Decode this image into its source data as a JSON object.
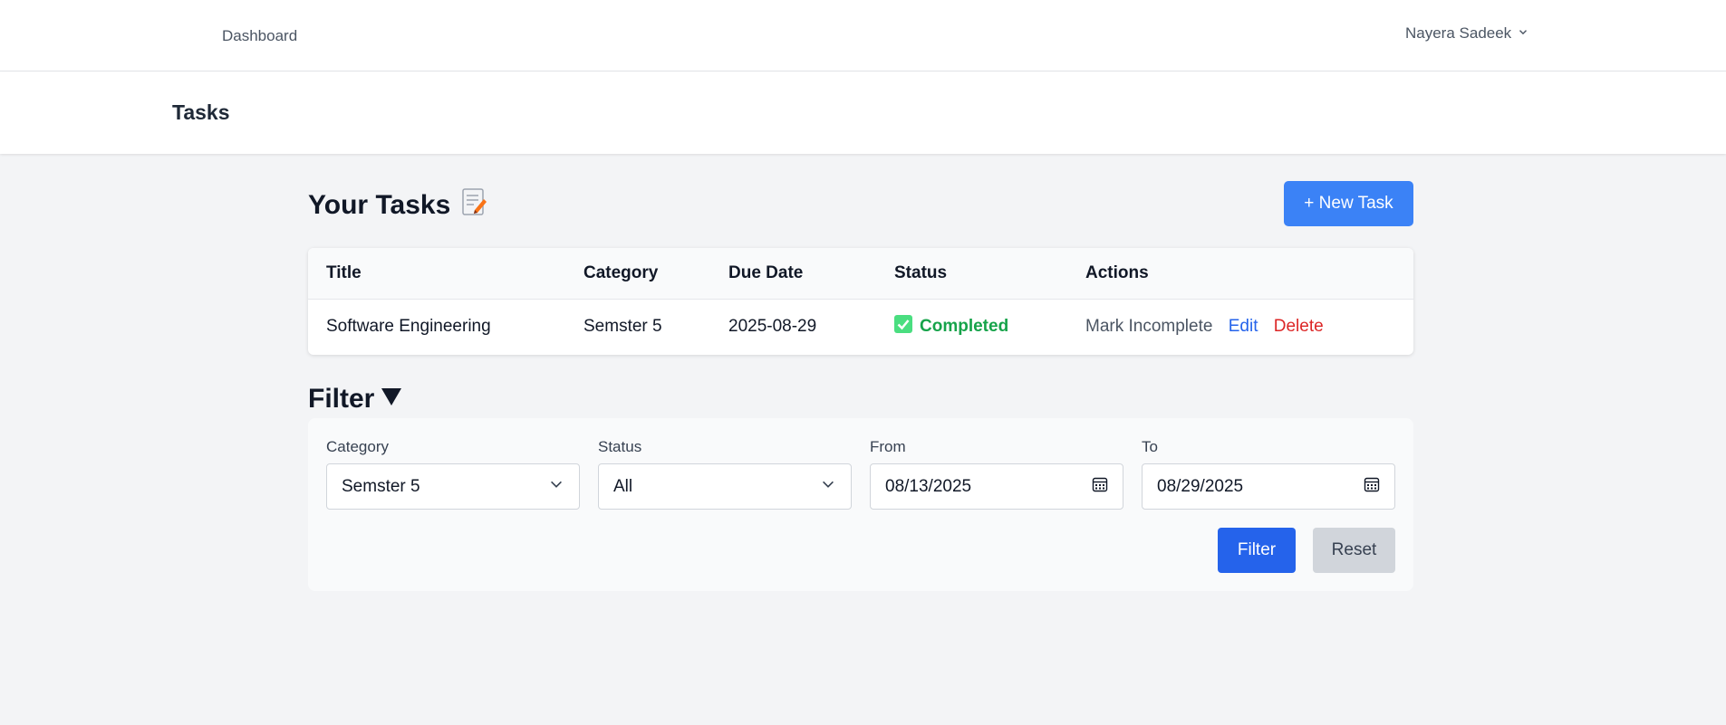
{
  "nav": {
    "dashboard_label": "Dashboard",
    "user_name": "Nayera Sadeek"
  },
  "header": {
    "title": "Tasks"
  },
  "tasks": {
    "heading": "Your Tasks",
    "new_task_label": "+ New Task",
    "columns": [
      "Title",
      "Category",
      "Due Date",
      "Status",
      "Actions"
    ],
    "rows": [
      {
        "title": "Software Engineering",
        "category": "Semster 5",
        "due_date": "2025-08-29",
        "status": "Completed",
        "actions": {
          "toggle": "Mark Incomplete",
          "edit": "Edit",
          "delete": "Delete"
        }
      }
    ]
  },
  "filter": {
    "heading": "Filter",
    "category_label": "Category",
    "category_value": "Semster 5",
    "status_label": "Status",
    "status_value": "All",
    "from_label": "From",
    "from_value": "08/13/2025",
    "to_label": "To",
    "to_value": "08/29/2025",
    "filter_button": "Filter",
    "reset_button": "Reset"
  },
  "colors": {
    "primary": "#3b82f6",
    "filter_button": "#2563eb",
    "completed": "#16a34a",
    "edit_link": "#2563eb",
    "delete_link": "#dc2626"
  },
  "icons": {
    "user_menu": "chevron-down-icon",
    "heading": "memo-icon",
    "status": "check-icon",
    "filter": "triangle-down-icon",
    "select": "chevron-down-icon",
    "date": "calendar-icon"
  }
}
